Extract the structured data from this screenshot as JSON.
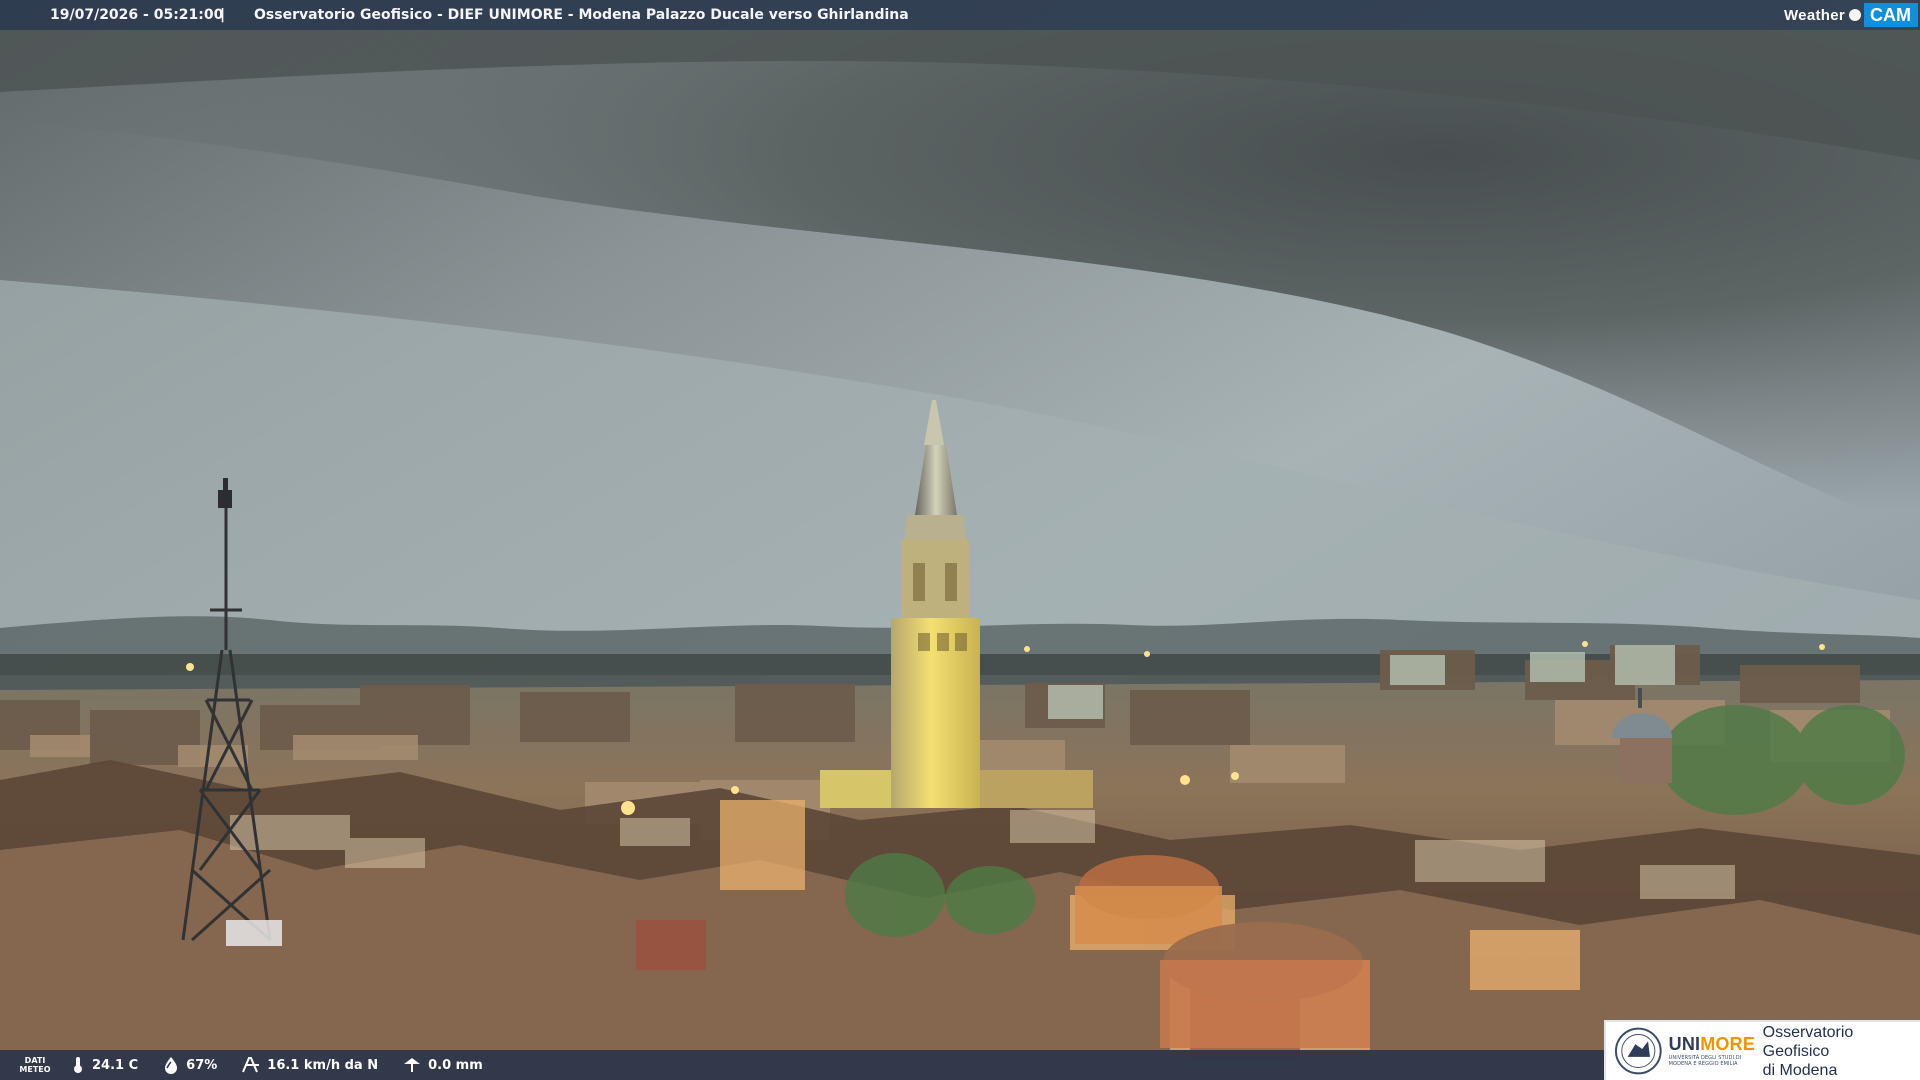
{
  "header": {
    "datetime": "19/07/2026 - 05:21:00",
    "separator": "|",
    "title": "Osservatorio Geofisico - DIEF UNIMORE - Modena Palazzo Ducale verso Ghirlandina"
  },
  "brand": {
    "word": "Weather",
    "cam": "CAM"
  },
  "meteo": {
    "label_line1": "DATI",
    "label_line2": "METEO",
    "temperature": "24.1 C",
    "humidity": "67%",
    "wind": "16.1 km/h da N",
    "rain": "0.0 mm",
    "icons": [
      "thermometer-icon",
      "humidity-drop-icon",
      "wind-icon",
      "rain-icon"
    ]
  },
  "logo": {
    "uni_prefix": "UNI",
    "uni_accent": "MORE",
    "uni_subtitle_line1": "UNIVERSITÀ DEGLI STUDI DI",
    "uni_subtitle_line2": "MODENA E REGGIO EMILIA",
    "observatory_line1": "Osservatorio Geofisico",
    "observatory_line2": "di Modena"
  },
  "colors": {
    "topbar": "#2b3a4e",
    "bottombar": "#24324b",
    "brand_cam": "#118fdd",
    "uni_accent": "#f29400",
    "uni_blue": "#2e3b56",
    "tower_light": "#f0dc45"
  }
}
